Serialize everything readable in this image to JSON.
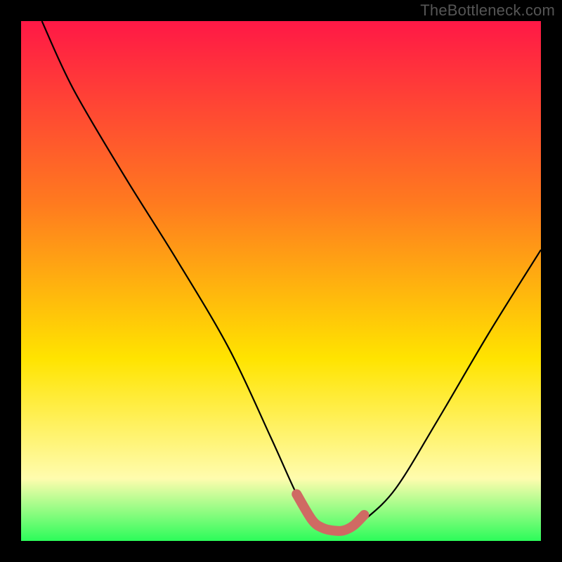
{
  "watermark": "TheBottleneck.com",
  "colors": {
    "bg": "#000000",
    "grad_top": "#ff1846",
    "grad_mid1": "#ff7a1f",
    "grad_mid2": "#ffe400",
    "grad_mid3": "#fffcae",
    "grad_bottom": "#2cfc5a",
    "curve": "#000000",
    "marker": "#cf6a63"
  },
  "chart_data": {
    "type": "line",
    "title": "",
    "xlabel": "",
    "ylabel": "",
    "xlim": [
      0,
      100
    ],
    "ylim": [
      0,
      100
    ],
    "series": [
      {
        "name": "bottleneck-curve",
        "x": [
          4,
          10,
          20,
          30,
          40,
          48,
          53,
          56,
          60,
          63,
          66,
          72,
          80,
          90,
          100
        ],
        "y": [
          100,
          87,
          70,
          54,
          37,
          20,
          9,
          4,
          2,
          2,
          4,
          10,
          23,
          40,
          56
        ]
      }
    ],
    "marker": {
      "name": "optimal-region",
      "x": [
        53,
        56,
        58,
        60,
        62,
        64,
        66
      ],
      "y": [
        9,
        4,
        2.5,
        2,
        2,
        3,
        5
      ]
    }
  }
}
